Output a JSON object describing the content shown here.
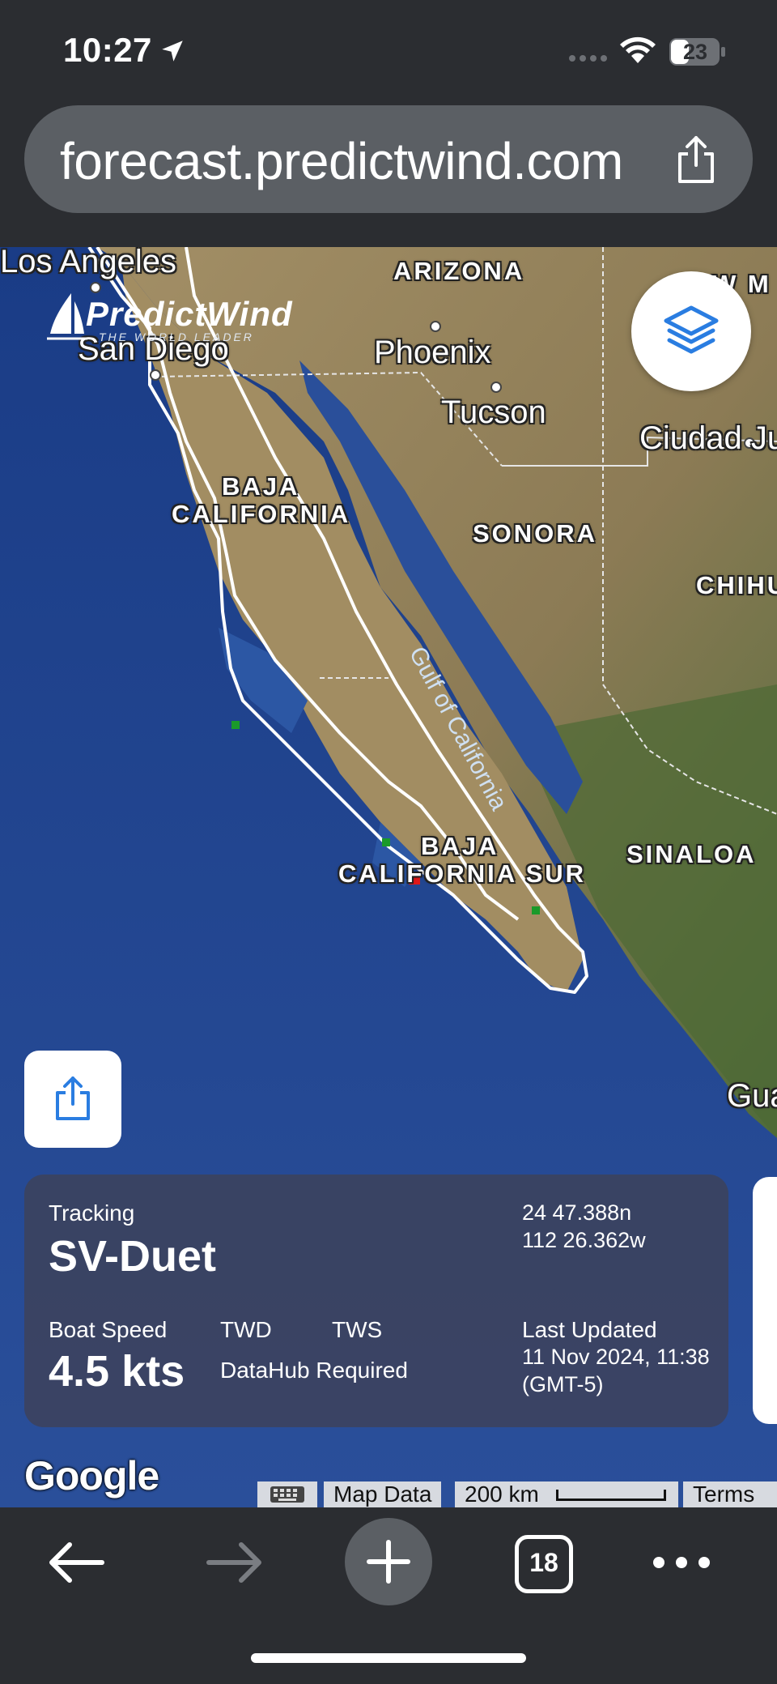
{
  "status_bar": {
    "time": "10:27",
    "battery": "23",
    "icons": [
      "location-arrow-icon",
      "cellular-signal-icon",
      "wifi-icon",
      "battery-icon"
    ]
  },
  "browser": {
    "url": "forecast.predictwind.com",
    "share_icon": "share-icon"
  },
  "map": {
    "brand": {
      "name": "PredictWind",
      "tagline": "THE WORLD LEADER"
    },
    "cities": [
      "Los Angeles",
      "San Diego",
      "Phoenix",
      "Tucson",
      "Ciudad Ju",
      "Gua"
    ],
    "states": [
      "ARIZONA",
      "BAJA",
      "CALIFORNIA",
      "SONORA",
      "CHIHU",
      "BAJA",
      "CALIFORNIA SUR",
      "SINALOA",
      "W M"
    ],
    "water": [
      "Gulf of California"
    ],
    "colors": {
      "ocean": "#1c3f8f",
      "land": "#9a8660",
      "track": "#ffffff",
      "current_position": "#e01818",
      "waypoint": "#1a9a2a"
    }
  },
  "tracking": {
    "label": "Tracking",
    "vessel": "SV-Duet",
    "lat": "24 47.388n",
    "lon": "112 26.362w",
    "boat_speed_label": "Boat Speed",
    "boat_speed_value": "4.5 kts",
    "twd_label": "TWD",
    "tws_label": "TWS",
    "wind_note": "DataHub Required",
    "last_updated_label": "Last Updated",
    "last_updated_value": "11 Nov 2024, 11:38",
    "timezone": "(GMT-5)"
  },
  "attribution": {
    "google": "Google",
    "map_data": "Map Data",
    "scale": "200 km",
    "terms": "Terms"
  },
  "toolbar": {
    "tabs_count": "18"
  }
}
